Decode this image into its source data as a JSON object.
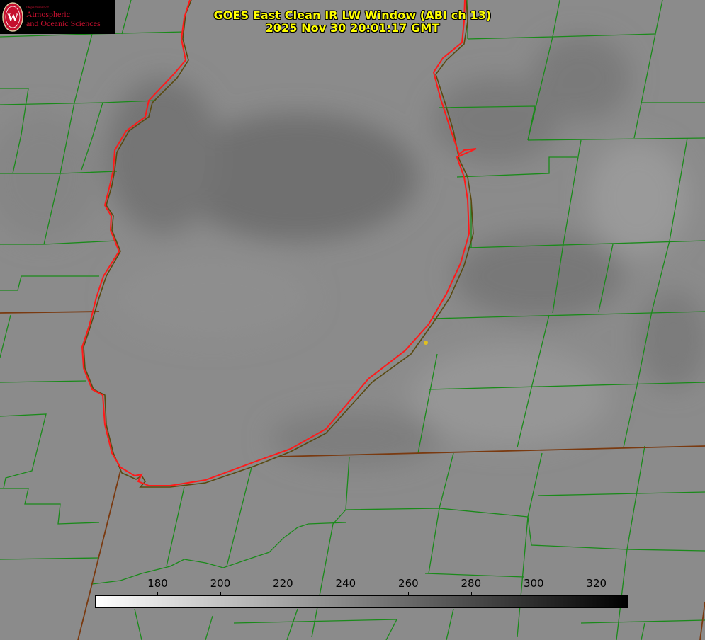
{
  "title": {
    "line1": "GOES East Clean IR LW Window (ABI ch 13)",
    "line2": "2025 Nov 30 20:01:17 GMT"
  },
  "logo": {
    "dept": "Department of",
    "line1": "Atmospheric",
    "line2": "and Oceanic Sciences",
    "seal_letter": "W"
  },
  "colorbar": {
    "min": 160,
    "max": 330,
    "ticks": [
      "180",
      "200",
      "220",
      "240",
      "260",
      "280",
      "300",
      "320"
    ],
    "gradient": [
      "#ffffff",
      "#000000"
    ]
  },
  "colors": {
    "coastline_primary": "#ff1a1a",
    "coastline_secondary": "#6b3a1a",
    "county_lines": "#1a8a1a",
    "state_lines": "#7a3a10",
    "title": "#ffff00",
    "marker": "#e0c020"
  }
}
